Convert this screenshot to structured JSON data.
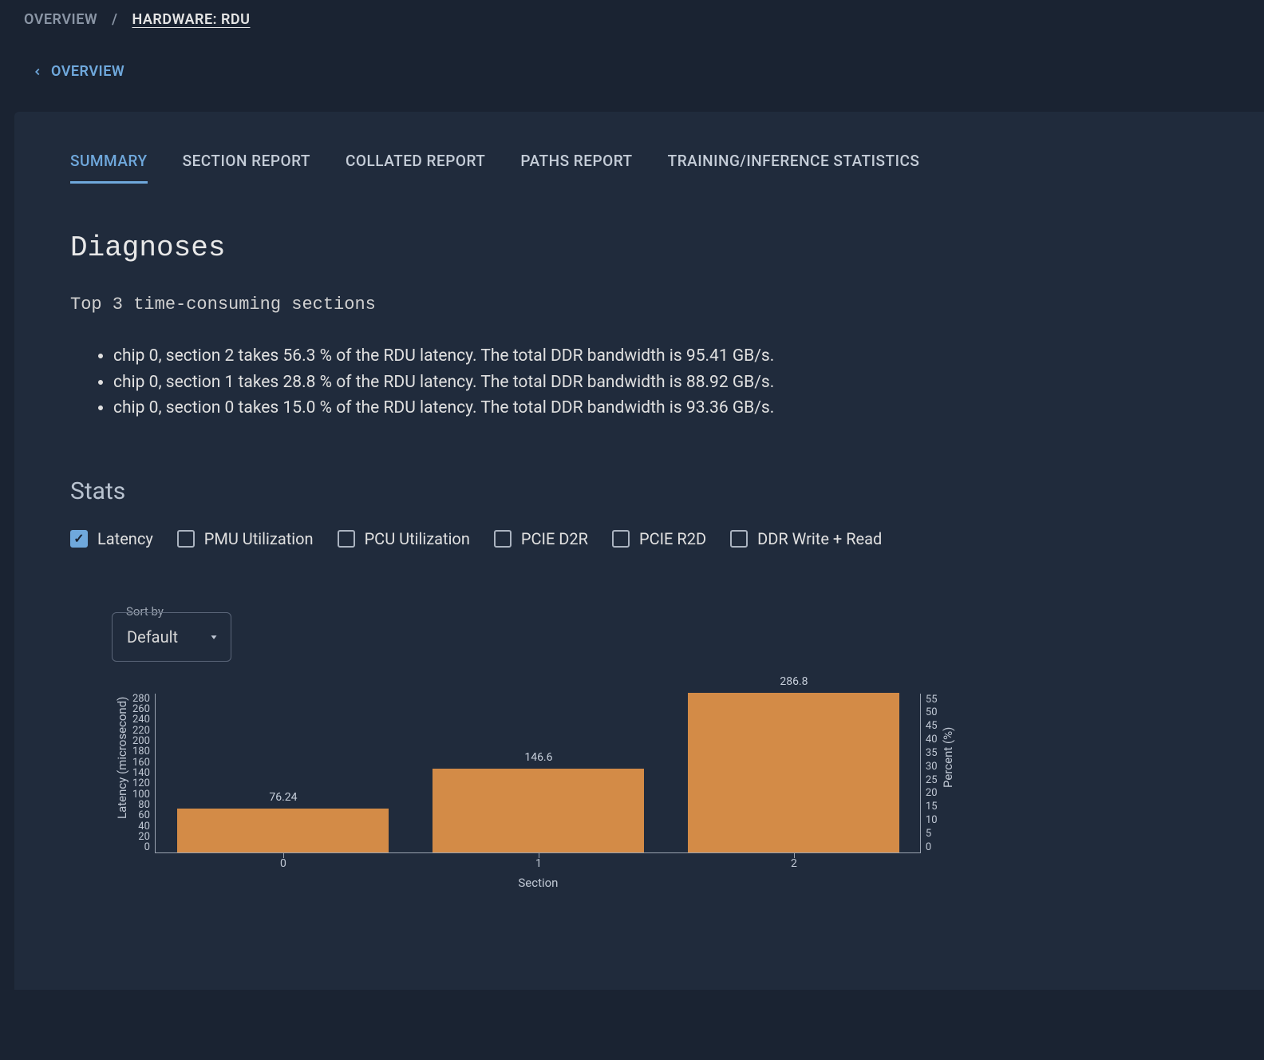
{
  "breadcrumb": {
    "root": "OVERVIEW",
    "sep": "/",
    "current": "HARDWARE: RDU"
  },
  "backlink": {
    "label": "OVERVIEW"
  },
  "tabs": [
    {
      "label": "SUMMARY",
      "active": true
    },
    {
      "label": "SECTION REPORT",
      "active": false
    },
    {
      "label": "COLLATED REPORT",
      "active": false
    },
    {
      "label": "PATHS REPORT",
      "active": false
    },
    {
      "label": "TRAINING/INFERENCE STATISTICS",
      "active": false
    }
  ],
  "diagnoses": {
    "title": "Diagnoses",
    "subtitle": "Top 3 time-consuming sections",
    "items": [
      "chip 0, section 2 takes 56.3 % of the RDU latency. The total DDR bandwidth is 95.41 GB/s.",
      "chip 0, section 1 takes 28.8 % of the RDU latency. The total DDR bandwidth is 88.92 GB/s.",
      "chip 0, section 0 takes 15.0 % of the RDU latency. The total DDR bandwidth is 93.36 GB/s."
    ]
  },
  "stats": {
    "title": "Stats",
    "checks": [
      {
        "label": "Latency",
        "checked": true
      },
      {
        "label": "PMU Utilization",
        "checked": false
      },
      {
        "label": "PCU Utilization",
        "checked": false
      },
      {
        "label": "PCIE D2R",
        "checked": false
      },
      {
        "label": "PCIE R2D",
        "checked": false
      },
      {
        "label": "DDR Write + Read",
        "checked": false
      }
    ],
    "sort": {
      "legend": "Sort by",
      "value": "Default"
    }
  },
  "chart_data": {
    "type": "bar",
    "categories": [
      "0",
      "1",
      "2"
    ],
    "values": [
      76.24,
      146.6,
      286.8
    ],
    "value_labels": [
      "76.24",
      "146.6",
      "286.8"
    ],
    "xlabel": "Section",
    "ylabel": "Latency (microsecond)",
    "y2label": "Percent (%)",
    "ylim": [
      0,
      280
    ],
    "yticks": [
      "280",
      "260",
      "240",
      "220",
      "200",
      "180",
      "160",
      "140",
      "120",
      "100",
      "80",
      "60",
      "40",
      "20",
      "0"
    ],
    "y2ticks": [
      "55",
      "50",
      "45",
      "40",
      "35",
      "30",
      "25",
      "20",
      "15",
      "10",
      "5",
      "0"
    ]
  }
}
